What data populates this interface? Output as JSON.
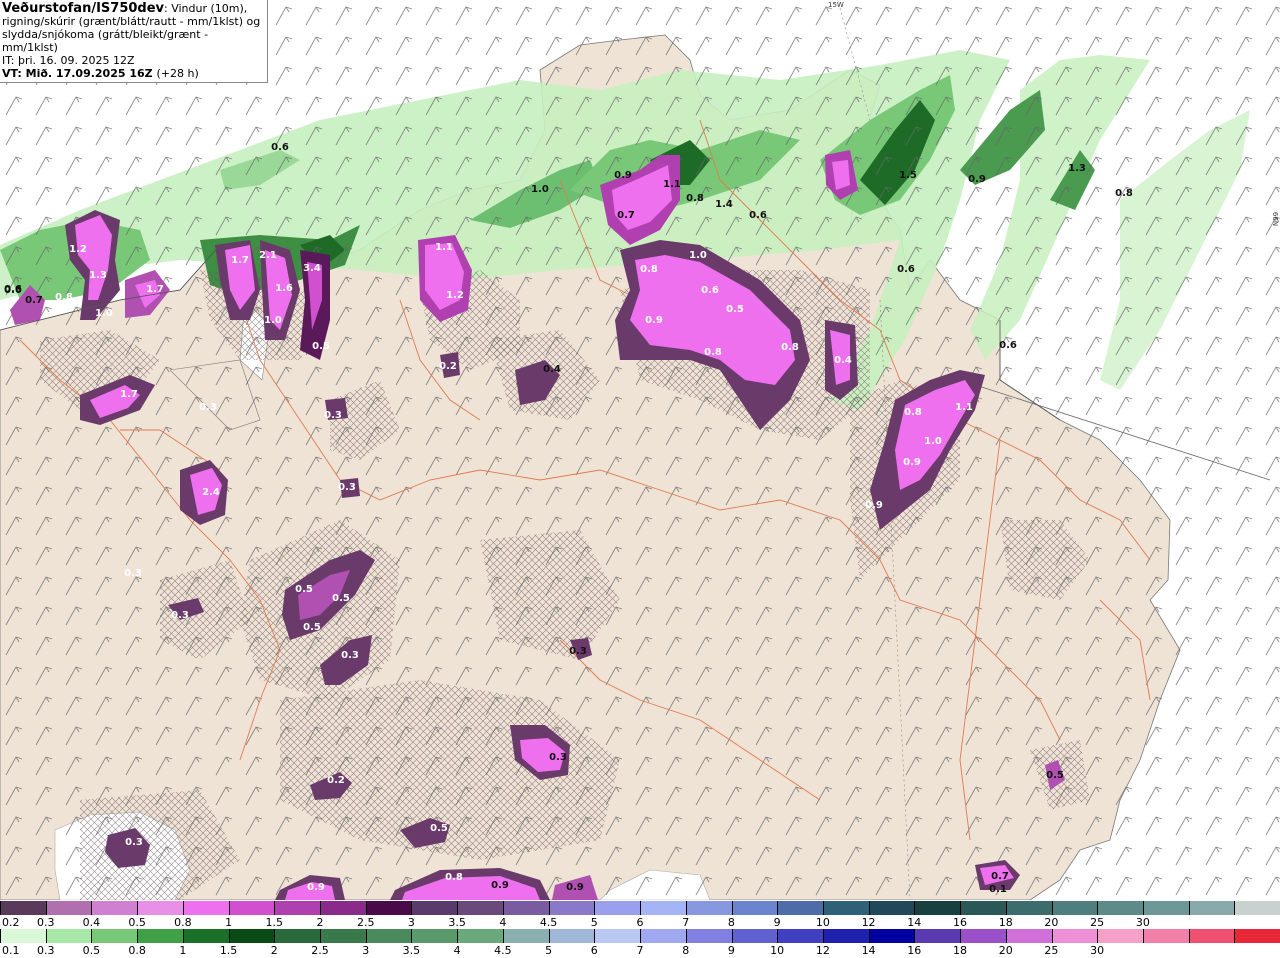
{
  "header": {
    "title": "Veðurstofan/IS750dev",
    "description": ": Vindur (10m), rigning/skúrir (grænt/blátt/rautt - mm/1klst) og slydda/snjókoma (grátt/bleikt/grænt - mm/1klst)",
    "it_line": "IT: þri. 16. 09. 2025 12Z",
    "vt_label": "VT: Mið. 17.09.2025 16Z",
    "vt_offset": "(+28 h)"
  },
  "grid_labels": {
    "top": "15W",
    "right": "66N"
  },
  "colors": {
    "sea": "#ffffff",
    "land": "#efe3d6",
    "roads": "#e07a50",
    "rain_light": "#c8f0c0",
    "rain_mid": "#78c878",
    "rain_dark": "#1e6b28",
    "snow_light": "#ee70ee",
    "snow_mid": "#c050c0",
    "snow_dark": "#6a3a6a"
  },
  "map_values": [
    "0.6",
    "1.0",
    "0.9",
    "1.1",
    "0.8",
    "1.4",
    "0.6",
    "1.5",
    "0.9",
    "1.3",
    "0.8",
    "0.6",
    "0.6",
    "1.2",
    "1.3",
    "1.0",
    "1.7",
    "0.8",
    "0.7",
    "0.6",
    "1.7",
    "2.1",
    "1.6",
    "1.0",
    "3.4",
    "0.5",
    "1.1",
    "1.2",
    "0.2",
    "0.7",
    "0.8",
    "1.0",
    "0.9",
    "0.6",
    "0.8",
    "0.5",
    "0.8",
    "0.4",
    "0.4",
    "0.3",
    "1.7",
    "0.3",
    "2.4",
    "0.3",
    "0.3",
    "0.5",
    "0.5",
    "0.5",
    "0.3",
    "0.3",
    "0.8",
    "0.9",
    "1.0",
    "1.1",
    "0.9",
    "0.3",
    "0.3",
    "0.2",
    "0.5",
    "0.3",
    "0.9",
    "0.8",
    "0.9",
    "0.9",
    "0.5",
    "0.7",
    "0.1",
    "0.6"
  ],
  "legend_snow": {
    "colors": [
      "#5a3a5a",
      "#b070b0",
      "#d080d0",
      "#e890e8",
      "#ee70ee",
      "#d050d0",
      "#b040b0",
      "#8a2a8a",
      "#4a0a4a",
      "#5a3a6a",
      "#6a4a7a",
      "#7a5aa0",
      "#8a78c8",
      "#9aa0ee",
      "#a4b4f4",
      "#8898e0",
      "#6a84d0",
      "#4e6ca8",
      "#2e6078",
      "#204858",
      "#184040",
      "#2a5858",
      "#3c6c6c",
      "#4e7e7e",
      "#5e8a8a",
      "#6e9898",
      "#88aaaa",
      "#c8d0d0"
    ],
    "ticks": [
      "0.2",
      "0.3",
      "0.4",
      "0.5",
      "0.8",
      "1",
      "1.5",
      "2",
      "2.5",
      "3",
      "3.5",
      "4",
      "4.5",
      "5",
      "6",
      "7",
      "8",
      "9",
      "10",
      "12",
      "14",
      "16",
      "18",
      "20",
      "25",
      "30"
    ]
  },
  "legend_rain": {
    "colors": [
      "#d8f8d8",
      "#a8e8a8",
      "#78c878",
      "#40a048",
      "#1a7028",
      "#0a4a14",
      "#2a6a3a",
      "#3a7a4a",
      "#4a8a5a",
      "#5a9a6a",
      "#6aa87a",
      "#8ab0b0",
      "#a0b8d8",
      "#b8c8f0",
      "#a0a8f0",
      "#8080e0",
      "#6060d0",
      "#4040c0",
      "#2020b0",
      "#0000a0",
      "#5a3ab0",
      "#9a50c8",
      "#d070d8",
      "#ee90d8",
      "#f4a0c8",
      "#f080a8",
      "#f05070",
      "#e82838"
    ],
    "ticks": [
      "0.1",
      "0.3",
      "0.5",
      "0.8",
      "1",
      "1.5",
      "2",
      "2.5",
      "3",
      "3.5",
      "4",
      "4.5",
      "5",
      "6",
      "7",
      "8",
      "9",
      "10",
      "12",
      "14",
      "16",
      "18",
      "20",
      "25",
      "30"
    ]
  }
}
